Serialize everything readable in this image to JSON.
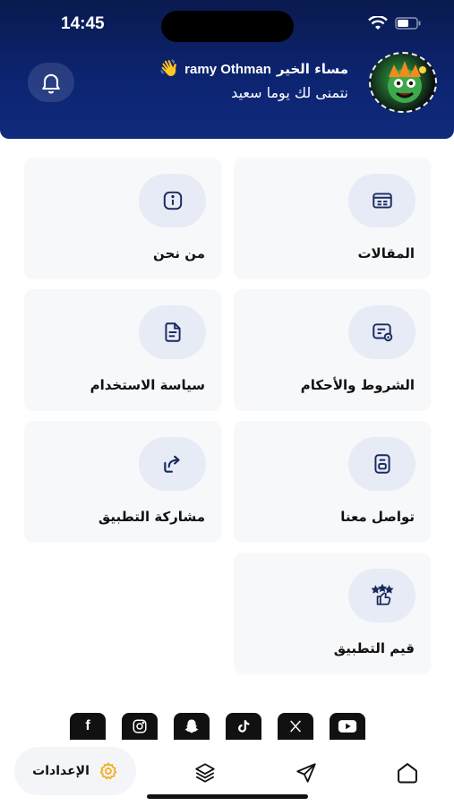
{
  "status_bar": {
    "time": "14:45"
  },
  "header": {
    "greeting": "مساء الخير",
    "user_name": "ramy Othman",
    "wave_icon": "waving-hand-icon",
    "subtitle": "نتمنى لك يوما سعيد",
    "accent_color": "#0c2470"
  },
  "menu": [
    {
      "label": "المقالات",
      "icon": "articles-icon"
    },
    {
      "label": "من نحن",
      "icon": "info-icon"
    },
    {
      "label": "الشروط والأحكام",
      "icon": "terms-icon"
    },
    {
      "label": "سياسة الاستخدام",
      "icon": "document-icon"
    },
    {
      "label": "تواصل معنا",
      "icon": "contact-icon"
    },
    {
      "label": "مشاركة التطبيق",
      "icon": "share-icon"
    },
    {
      "label": "قيم التطبيق",
      "icon": "rate-icon"
    }
  ],
  "social": [
    {
      "name": "facebook",
      "glyph": "f"
    },
    {
      "name": "instagram",
      "glyph": ""
    },
    {
      "name": "snapchat",
      "glyph": ""
    },
    {
      "name": "tiktok",
      "glyph": ""
    },
    {
      "name": "x",
      "glyph": "𝕏"
    },
    {
      "name": "youtube",
      "glyph": ""
    }
  ],
  "nav": {
    "settings_label": "الإعدادات",
    "settings_icon": "gear-icon",
    "settings_color": "#f2b01e"
  }
}
